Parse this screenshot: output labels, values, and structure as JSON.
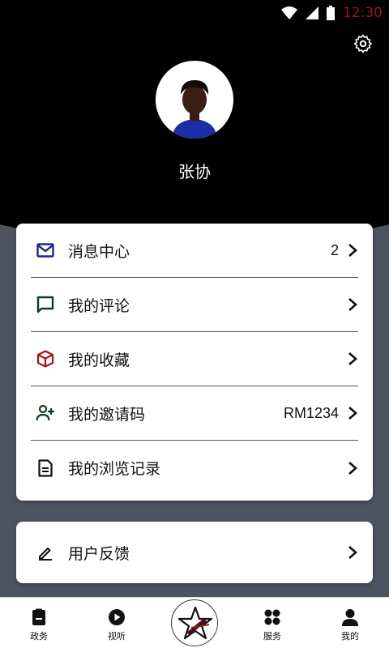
{
  "status_bar": {
    "time": "12:30"
  },
  "profile": {
    "name": "张协"
  },
  "menu": [
    {
      "label": "消息中心",
      "value": "2",
      "icon": "mail-icon",
      "icon_color": "#1d2a8a"
    },
    {
      "label": "我的评论",
      "value": "",
      "icon": "comment-icon",
      "icon_color": "#0f3d22"
    },
    {
      "label": "我的收藏",
      "value": "",
      "icon": "box-icon",
      "icon_color": "#a11"
    },
    {
      "label": "我的邀请码",
      "value": "RM1234",
      "icon": "add-user-icon",
      "icon_color": "#0f3d22"
    },
    {
      "label": "我的浏览记录",
      "value": "",
      "icon": "document-icon",
      "icon_color": "#111"
    }
  ],
  "feedback": {
    "label": "用户反馈",
    "icon": "edit-icon"
  },
  "tabs": [
    {
      "label": "政务",
      "icon": "clipboard-icon"
    },
    {
      "label": "视听",
      "icon": "play-icon"
    },
    {
      "label": "服务",
      "icon": "grid-icon"
    },
    {
      "label": "我的",
      "icon": "person-icon"
    }
  ],
  "colors": {
    "header_bg": "#000000",
    "page_bg": "#4d5360",
    "clock": "#8b1b1b"
  }
}
